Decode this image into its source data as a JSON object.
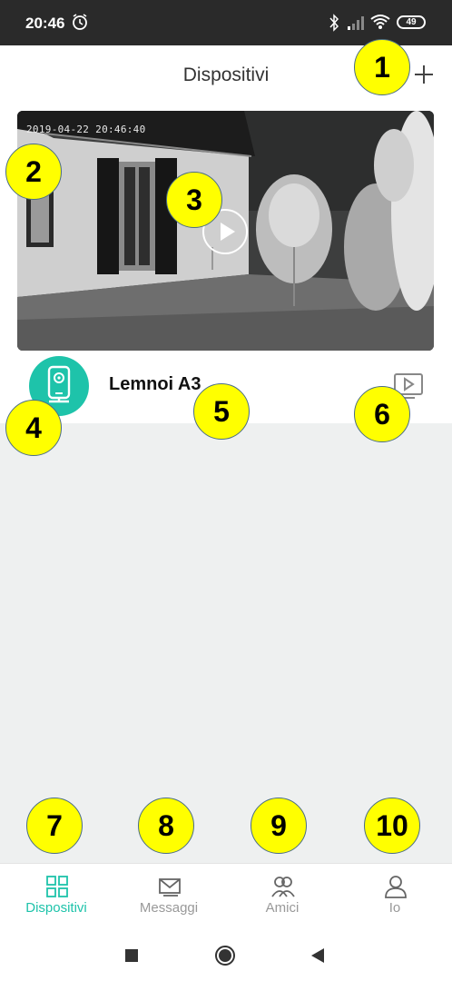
{
  "status_bar": {
    "time": "20:46",
    "battery": "49",
    "icons": [
      "alarm-icon",
      "bluetooth-icon",
      "signal-icon",
      "wifi-icon",
      "battery-icon"
    ]
  },
  "header": {
    "title": "Dispositivi",
    "add_icon": "plus-icon"
  },
  "device": {
    "name": "Lemnoi A3",
    "preview_timestamp": "2019-04-22 20:46:40",
    "icon": "camera-icon",
    "play_icon": "play-icon",
    "playback_icon": "playback-icon"
  },
  "markers": [
    "1",
    "2",
    "3",
    "4",
    "5",
    "6",
    "7",
    "8",
    "9",
    "10"
  ],
  "bottom_nav": {
    "items": [
      {
        "label": "Dispositivi",
        "icon": "grid-icon",
        "active": true
      },
      {
        "label": "Messaggi",
        "icon": "mail-icon",
        "active": false
      },
      {
        "label": "Amici",
        "icon": "friends-icon",
        "active": false
      },
      {
        "label": "Io",
        "icon": "user-icon",
        "active": false
      }
    ]
  },
  "system_nav": [
    "recents-icon",
    "home-icon",
    "back-icon"
  ],
  "colors": {
    "accent": "#1ec3aa",
    "marker": "#ffff00",
    "status_bar": "#2a2a2a",
    "background": "#eef0f0"
  }
}
